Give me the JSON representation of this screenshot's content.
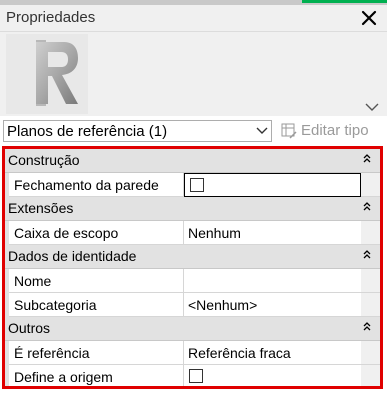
{
  "panel": {
    "title": "Propriedades",
    "accent_color": "#00b050",
    "highlight_color": "#e00000"
  },
  "type_selector": {
    "value": "Planos de referência (1)",
    "edit_type_label": "Editar tipo"
  },
  "groups": [
    {
      "label": "Construção",
      "rows": [
        {
          "name": "Fechamento da parede",
          "value_type": "checkbox",
          "checked": false,
          "active": true
        }
      ]
    },
    {
      "label": "Extensões",
      "rows": [
        {
          "name": "Caixa de escopo",
          "value": "Nenhum"
        }
      ]
    },
    {
      "label": "Dados de identidade",
      "rows": [
        {
          "name": "Nome",
          "value": ""
        },
        {
          "name": "Subcategoria",
          "value": "<Nenhum>"
        }
      ]
    },
    {
      "label": "Outros",
      "rows": [
        {
          "name": "É referência",
          "value": "Referência fraca"
        },
        {
          "name": "Define a origem",
          "value_type": "checkbox",
          "checked": false
        }
      ]
    }
  ]
}
